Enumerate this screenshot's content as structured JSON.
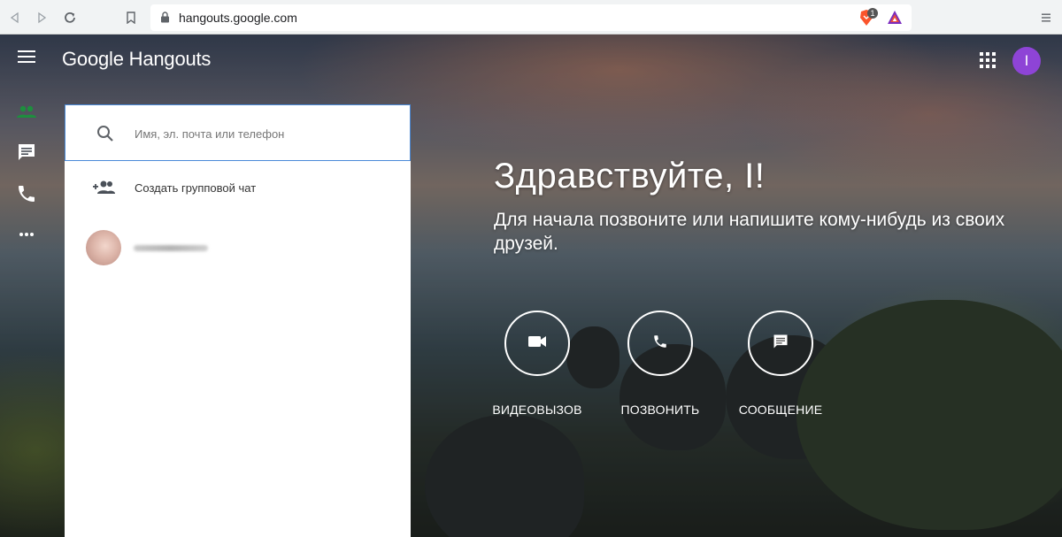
{
  "browser": {
    "url": "hangouts.google.com",
    "extension_badge": "1"
  },
  "app": {
    "logo_text": "Google Hangouts",
    "user_initial": "I",
    "user_avatar_color": "#8e44d6",
    "rail": [
      "contacts-icon",
      "chat-icon",
      "phone-icon",
      "more-icon"
    ],
    "rail_active_color": "#1e8e3e"
  },
  "panel": {
    "search_placeholder": "Имя, эл. почта или телефон",
    "group_chat_label": "Создать групповой чат"
  },
  "welcome": {
    "greeting": "Здравствуйте, I!",
    "subtitle": "Для начала позвоните или напишите кому-нибудь из своих друзей.",
    "actions": {
      "video": "ВИДЕОВЫЗОВ",
      "call": "ПОЗВОНИТЬ",
      "message": "СООБЩЕНИЕ"
    }
  }
}
